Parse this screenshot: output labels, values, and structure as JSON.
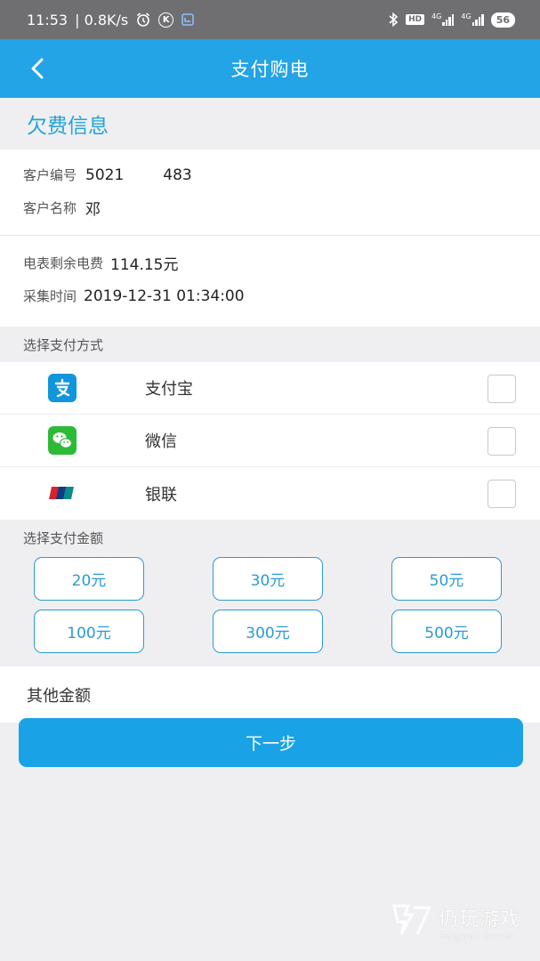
{
  "status_bar": {
    "time": "11:53",
    "speed": "| 0.8K/s",
    "network_labels": [
      "4G",
      "4G"
    ],
    "hd_label": "HD",
    "battery": "56",
    "k_badge": "K"
  },
  "navbar": {
    "title": "支付购电"
  },
  "arrears": {
    "heading": "欠费信息",
    "customer_id_label": "客户编号",
    "customer_id_value": "5021",
    "customer_id_value_tail": "483",
    "customer_name_label": "客户名称",
    "customer_name_value": "邓",
    "balance_label": "电表剩余电费",
    "balance_value": "114.15元",
    "collect_time_label": "采集时间",
    "collect_time_value": "2019-12-31 01:34:00"
  },
  "payment_method": {
    "title": "选择支付方式",
    "options": [
      {
        "label": "支付宝",
        "icon": "alipay-icon",
        "color": "#1296db"
      },
      {
        "label": "微信",
        "icon": "wechat-icon",
        "color": "#2dbb37"
      },
      {
        "label": "银联",
        "icon": "unionpay-icon",
        "color": "#d8232a"
      }
    ]
  },
  "payment_amount": {
    "title": "选择支付金额",
    "options": [
      "20元",
      "30元",
      "50元",
      "100元",
      "300元",
      "500元"
    ],
    "other_label": "其他金额"
  },
  "next_button": "下一步",
  "watermark": {
    "cn": "仍玩游戏",
    "en": "Rengwan Games"
  },
  "colors": {
    "primary": "#22a4e6",
    "accent_text": "#25a3d8",
    "button": "#1aa2e6"
  }
}
